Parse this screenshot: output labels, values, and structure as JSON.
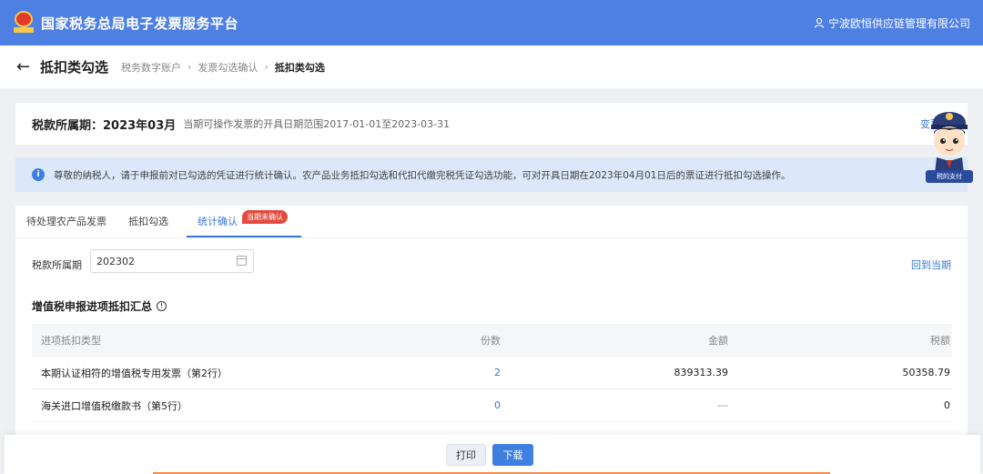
{
  "header": {
    "app_title": "国家税务总局电子发票服务平台",
    "company": "宁波欧恒供应链管理有限公司"
  },
  "breadcrumb": {
    "title": "抵扣类勾选",
    "items": [
      "税务数字账户",
      "发票勾选确认",
      "抵扣类勾选"
    ]
  },
  "period": {
    "label": "税款所属期：2023年03月",
    "note": "当期可操作发票的开具日期范围2017-01-01至2023-03-31",
    "change_label": "变更"
  },
  "notice": {
    "text": "尊敬的纳税人，请于申报前对已勾选的凭证进行统计确认。农产品业务抵扣勾选和代扣代缴完税凭证勾选功能，可对开具日期在2023年04月01日后的票证进行抵扣勾选操作。"
  },
  "mascot": {
    "stamp_text": "税的支付"
  },
  "tabs": [
    {
      "label": "待处理农产品发票",
      "active": false
    },
    {
      "label": "抵扣勾选",
      "active": false
    },
    {
      "label": "统计确认",
      "active": true
    }
  ],
  "tab_badge": "当期未确认",
  "filter": {
    "label": "税款所属期",
    "value": "202302",
    "back_current": "回到当期"
  },
  "summary": {
    "title": "增值税申报进项抵扣汇总",
    "columns": [
      "进项抵扣类型",
      "份数",
      "金额",
      "税额"
    ],
    "rows": [
      {
        "type": "本期认证相符的增值税专用发票（第2行）",
        "count": "2",
        "amount": "839313.39",
        "tax": "50358.79"
      },
      {
        "type": "海关进口增值税缴款书（第5行）",
        "count": "0",
        "amount": "---",
        "tax": "0"
      }
    ]
  },
  "footer": {
    "print_label": "打印",
    "download_label": "下载"
  },
  "colors": {
    "primary": "#4e80e3",
    "link": "#3a78d8",
    "badge": "#e34b3f",
    "notice_bg": "#dce8f9"
  }
}
